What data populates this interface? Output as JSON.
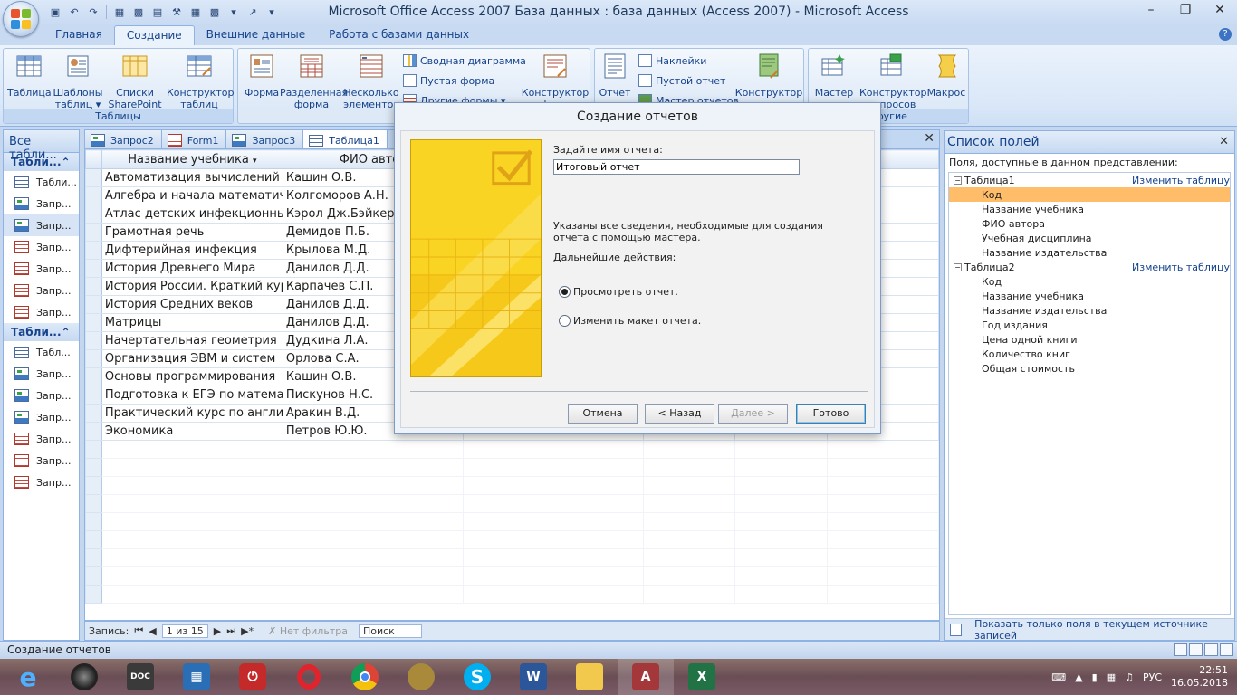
{
  "window": {
    "title": "Microsoft Office Access 2007 База данных : база данных (Access 2007) - Microsoft Access"
  },
  "ribbon": {
    "tabs": [
      "Главная",
      "Создание",
      "Внешние данные",
      "Работа с базами данных"
    ],
    "active_tab": "Создание",
    "groups": {
      "tables": {
        "label": "Таблицы",
        "buttons": [
          "Таблица",
          "Шаблоны таблиц ▾",
          "Списки SharePoint ▾",
          "Конструктор таблиц"
        ]
      },
      "forms": {
        "buttons": [
          "Форма",
          "Разделенная форма",
          "Несколько элементов"
        ],
        "small": [
          "Сводная диаграмма",
          "Пустая форма",
          "Другие формы ▾"
        ],
        "constructor": "Конструктор форм"
      },
      "reports": {
        "buttons": [
          "Отчет"
        ],
        "small": [
          "Наклейки",
          "Пустой отчет",
          "Мастер отчетов"
        ],
        "constructor": "Конструктор отчетов"
      },
      "other": {
        "label": "Другие",
        "buttons": [
          "Мастер запросов",
          "Конструктор запросов",
          "Макрос"
        ]
      }
    }
  },
  "nav_pane": {
    "title": "Все табли...",
    "groups": [
      {
        "title": "Табли...",
        "items": [
          {
            "label": "Табли...",
            "type": "table"
          },
          {
            "label": "Запр...",
            "type": "query"
          },
          {
            "label": "Запр...",
            "type": "query"
          },
          {
            "label": "Запр...",
            "type": "form"
          },
          {
            "label": "Запр...",
            "type": "form"
          },
          {
            "label": "Запр...",
            "type": "form"
          },
          {
            "label": "Запр...",
            "type": "form"
          }
        ]
      },
      {
        "title": "Табли...",
        "items": [
          {
            "label": "Табл...",
            "type": "table"
          },
          {
            "label": "Запр...",
            "type": "query"
          },
          {
            "label": "Запр...",
            "type": "query"
          },
          {
            "label": "Запр...",
            "type": "query"
          },
          {
            "label": "Запр...",
            "type": "form"
          },
          {
            "label": "Запр...",
            "type": "form"
          },
          {
            "label": "Запр...",
            "type": "form"
          }
        ]
      }
    ]
  },
  "doc_tabs": [
    "Запрос2",
    "Form1",
    "Запрос3",
    "Таблица1"
  ],
  "datasheet": {
    "columns": [
      "Название учебника",
      "ФИО автор"
    ],
    "rows": [
      [
        "Автоматизация вычислений",
        "Кашин О.В."
      ],
      [
        "Алгебра и начала математичес",
        "Колгоморов А.Н."
      ],
      [
        "Атлас детских инфекционных з",
        "Кэрол Дж.Бэйкер"
      ],
      [
        "Грамотная речь",
        "Демидов П.Б."
      ],
      [
        "Дифтерийная инфекция",
        "Крылова М.Д."
      ],
      [
        "История Древнего Мира",
        "Данилов Д.Д."
      ],
      [
        "История России. Краткий курс",
        "Карпачев С.П."
      ],
      [
        "История Средних веков",
        "Данилов Д.Д."
      ],
      [
        "Матрицы",
        "Данилов Д.Д."
      ],
      [
        "Начертательная геометрия",
        "Дудкина Л.А."
      ],
      [
        "Организация ЭВМ и систем",
        "Орлова С.А."
      ],
      [
        "Основы программирования",
        "Кашин О.В."
      ],
      [
        "Подготовка к ЕГЭ по математи",
        "Пискунов Н.С."
      ],
      [
        "Практический курс по английс",
        "Аракин В.Д."
      ],
      [
        "Экономика",
        "Петров Ю.Ю."
      ]
    ]
  },
  "record_nav": {
    "label": "Запись:",
    "position": "1 из 15",
    "filter": "Нет фильтра",
    "search": "Поиск"
  },
  "field_list": {
    "title": "Список полей",
    "subtitle": "Поля, доступные в данном представлении:",
    "tables": [
      {
        "name": "Таблица1",
        "edit_link": "Изменить таблицу",
        "fields": [
          "Код",
          "Название учебника",
          "ФИО автора",
          "Учебная дисциплина",
          "Название издательства"
        ]
      },
      {
        "name": "Таблица2",
        "edit_link": "Изменить таблицу",
        "fields": [
          "Код",
          "Название учебника",
          "Название издательства",
          "Год издания",
          "Цена одной книги",
          "Количество книг",
          "Общая стоимость"
        ]
      }
    ],
    "highlighted_field": "Код",
    "footer": "Показать только поля в текущем источнике записей"
  },
  "dialog": {
    "title": "Создание отчетов",
    "name_prompt": "Задайте имя отчета:",
    "name_value": "Итоговый отчет",
    "info": "Указаны все сведения, необходимые для создания отчета с помощью мастера.",
    "next_actions": "Дальнейшие действия:",
    "option_preview": "Просмотреть отчет.",
    "option_modify": "Изменить макет отчета.",
    "selected_option": "preview",
    "buttons": {
      "cancel": "Отмена",
      "back": "< Назад",
      "next": "Далее >",
      "finish": "Готово"
    }
  },
  "statusbar": {
    "text": "Создание отчетов"
  },
  "taskbar": {
    "apps": [
      "ie",
      "speaker",
      "doc",
      "calc",
      "power",
      "opera",
      "chrome",
      "media",
      "skype",
      "word",
      "explorer",
      "access",
      "excel"
    ],
    "active": "access",
    "language": "РУС",
    "time": "22:51",
    "date": "16.05.2018"
  },
  "colors": {
    "accent": "#15428b",
    "field_highlight": "#ffbd69",
    "wizard_yellow": "#f9d422"
  }
}
